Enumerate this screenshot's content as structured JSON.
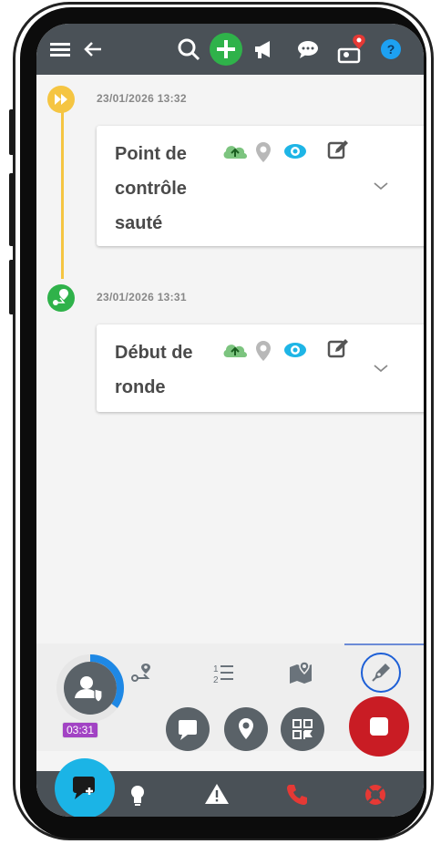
{
  "colors": {
    "topbar": "#4a5157",
    "accent_green": "#2fb24a",
    "accent_blue": "#1da1f2",
    "timeline": "#f5c542",
    "stop_red": "#c91c24",
    "timer_purple": "#a243c4"
  },
  "topbar": {
    "icons": [
      "menu-icon",
      "back-arrow-icon",
      "search-icon",
      "add-icon",
      "megaphone-icon",
      "chat-icon",
      "user-location-icon",
      "help-icon"
    ],
    "help_label": "?"
  },
  "events": [
    {
      "timestamp": "23/01/2026 13:32",
      "title_lines": [
        "Point de",
        "contrôle",
        "sauté"
      ],
      "icon": "skip-forward-icon"
    },
    {
      "timestamp": "23/01/2026 13:31",
      "title_lines": [
        "Début de",
        "ronde"
      ],
      "icon": "route-start-icon"
    }
  ],
  "bottom_tabs": [
    {
      "name": "route-tab",
      "icon": "route-icon"
    },
    {
      "name": "list-tab",
      "icon": "numbered-list-icon"
    },
    {
      "name": "map-tab",
      "icon": "map-icon"
    },
    {
      "name": "pen-tab",
      "icon": "pen-icon",
      "active": true
    }
  ],
  "timer": {
    "label": "03:31",
    "progress": 0.35
  },
  "navbar": {
    "icons": [
      "lightbulb-icon",
      "warning-icon",
      "phone-icon",
      "sos-icon"
    ]
  }
}
